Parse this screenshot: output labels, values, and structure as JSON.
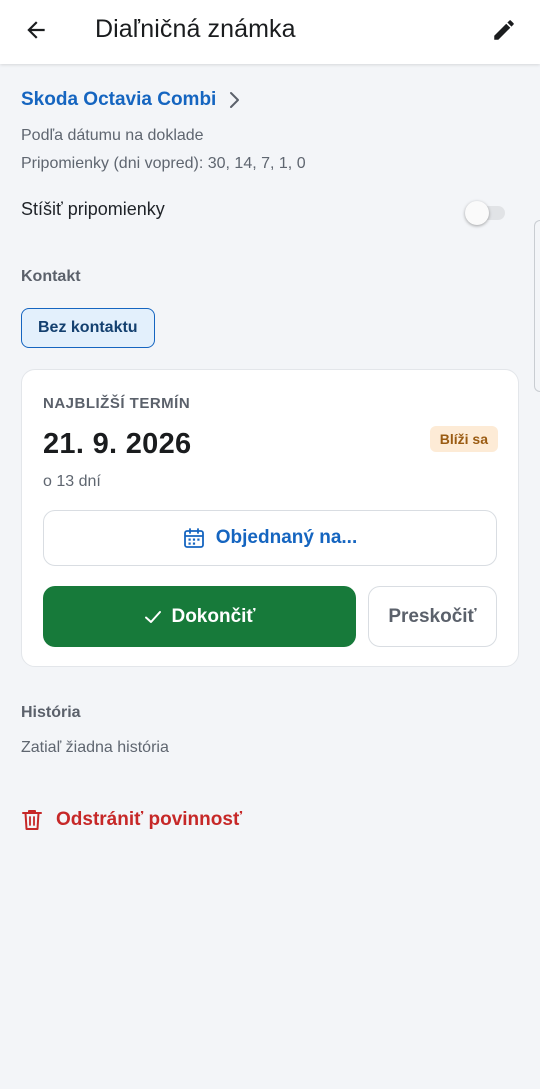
{
  "appbar": {
    "back_icon": "arrow-left-icon",
    "title": "Diaľničná známka",
    "edit_icon": "pencil-icon"
  },
  "vehicle": {
    "name": "Skoda Octavia Combi",
    "chevron_icon": "chevron-right-icon"
  },
  "meta": {
    "basis": "Podľa dátumu na doklade",
    "reminders": "Pripomienky (dni vopred): 30, 14, 7, 1, 0"
  },
  "mute": {
    "label": "Stíšiť pripomienky",
    "enabled": false
  },
  "contact": {
    "title": "Kontakt",
    "chip": "Bez kontaktu"
  },
  "next_term": {
    "caption": "NAJBLIŽŠÍ TERMÍN",
    "date": "21. 9. 2026",
    "badge": "Blíži sa",
    "days": "o 13 dní",
    "ordered_label": "Objednaný na...",
    "ordered_icon": "calendar-icon",
    "done_label": "Dokončiť",
    "done_icon": "check-icon",
    "skip_label": "Preskočiť"
  },
  "history": {
    "title": "História",
    "empty": "Zatiaľ žiadna história"
  },
  "delete": {
    "label": "Odstrániť povinnosť",
    "icon": "trash-icon"
  },
  "colors": {
    "accent": "#1565c0",
    "success": "#177a3a",
    "danger": "#c62828",
    "warning_bg": "#fdebd6",
    "warning_fg": "#9a5b12",
    "background": "#f3f5f8"
  }
}
